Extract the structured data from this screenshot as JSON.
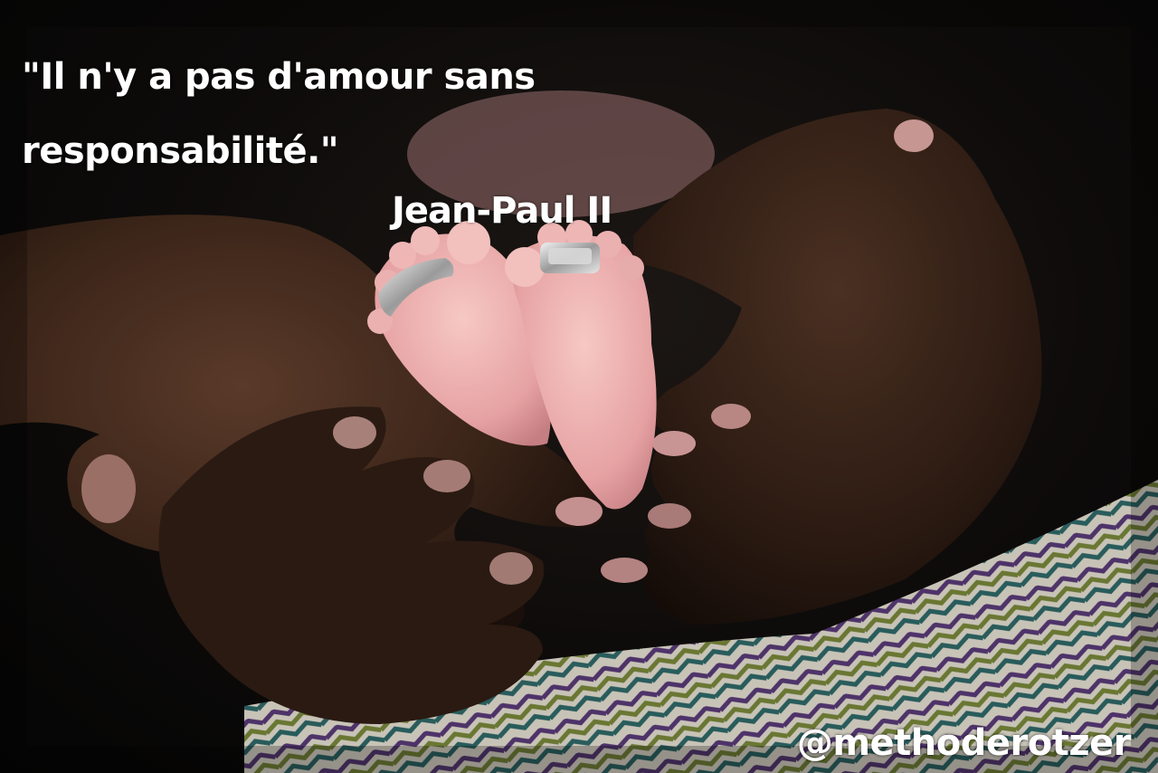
{
  "image": {
    "quote_line1": "\"Il n'y a pas d'amour sans",
    "quote_line2": "responsabilité.\"",
    "author": "Jean-Paul II",
    "handle": "@methoderotzer"
  },
  "colors": {
    "background": "#0b0b0c",
    "skin_dark": "#3a2418",
    "skin_baby": "#e8a9a9",
    "text": "#ffffff"
  }
}
